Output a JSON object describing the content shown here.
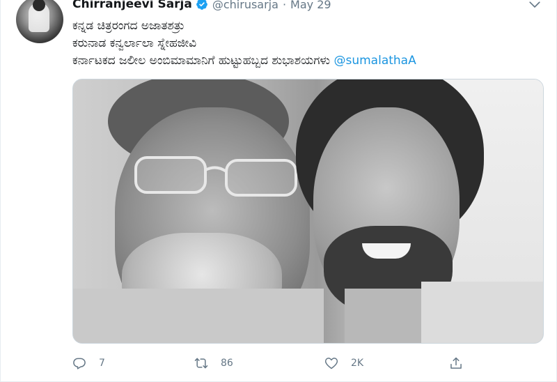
{
  "tweet": {
    "author": {
      "name": "Chirranjeevi Sarja",
      "handle": "@chirusarja",
      "separator": "·",
      "date": "May 29",
      "verified": true
    },
    "text_lines": [
      "ಕನ್ನಡ ಚಿತ್ರರಂಗದ ಅಜಾತಶತ್ರು",
      "ಕರುನಾಡ ಕನ್ವರ್ಲಾಲಾ ಸ್ನೇಹಜೀವಿ",
      "ಕರ್ನಾಟಕದ ಜಲೀಲ ಅಂಬಿಮಾಮಾನಿಗೆ ಹುಟ್ಟುಹಬ್ಬದ ಶುಭಾಶಯಗಳು"
    ],
    "mention": "@sumalathaA",
    "image_alt": "Black and white photo of two men",
    "actions": {
      "reply": {
        "count": "7",
        "icon": "reply-icon"
      },
      "retweet": {
        "count": "86",
        "icon": "retweet-icon"
      },
      "like": {
        "count": "2K",
        "icon": "heart-icon"
      },
      "share": {
        "icon": "share-icon"
      }
    },
    "colors": {
      "accent": "#1b95e0",
      "verified": "#1da1f2",
      "muted": "#657786",
      "text": "#14171a"
    }
  }
}
